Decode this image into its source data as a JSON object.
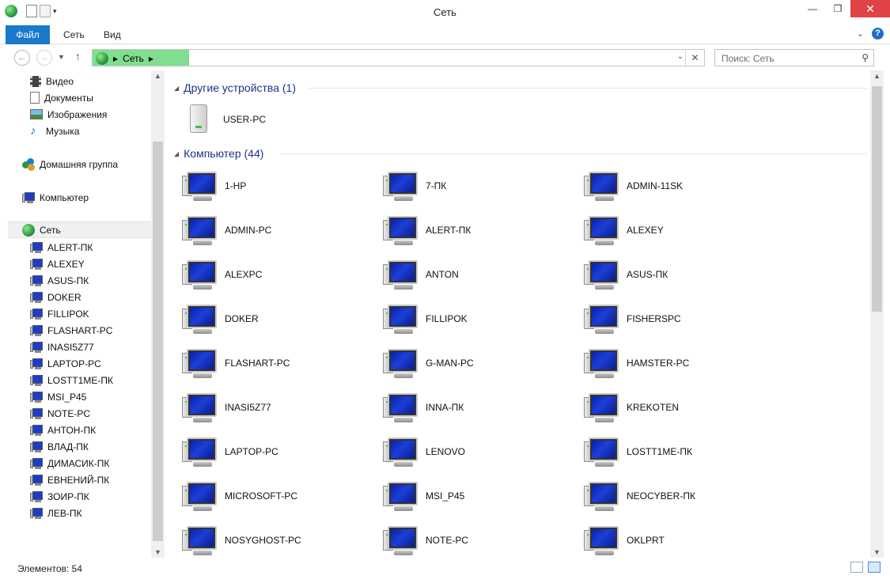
{
  "window": {
    "title": "Сеть"
  },
  "ribbon": {
    "tabs": [
      "Файл",
      "Сеть",
      "Вид"
    ]
  },
  "address": {
    "crumb": "Сеть"
  },
  "search": {
    "placeholder": "Поиск: Сеть"
  },
  "nav": {
    "libraries": [
      "Видео",
      "Документы",
      "Изображения",
      "Музыка"
    ],
    "homegroup": "Домашняя группа",
    "computer": "Компьютер",
    "network": "Сеть",
    "network_items": [
      "ALERT-ПК",
      "ALEXEY",
      "ASUS-ПК",
      "DOKER",
      "FILLIPOK",
      "FLASHART-PC",
      "INASI5Z77",
      "LAPTOP-PC",
      "LOSTT1ME-ПК",
      "MSI_P45",
      "NOTE-PC",
      "АНТОН-ПК",
      "ВЛАД-ПК",
      "ДИМАСИК-ПК",
      "ЕВНЕНИЙ-ПК",
      "ЗОИР-ПК",
      "ЛЕВ-ПК"
    ]
  },
  "groups": {
    "other": {
      "title": "Другие устройства (1)",
      "items": [
        "USER-PC"
      ]
    },
    "computers": {
      "title": "Компьютер (44)",
      "items": [
        "1-HP",
        "7-ПК",
        "ADMIN-11SK",
        "ADMIN-PC",
        "ALERT-ПК",
        "ALEXEY",
        "ALEXPC",
        "ANTON",
        "ASUS-ПК",
        "DOKER",
        "FILLIPOK",
        "FISHERSPC",
        "FLASHART-PC",
        "G-MAN-PC",
        "HAMSTER-PC",
        "INASI5Z77",
        "INNA-ПК",
        "KREKOTEN",
        "LAPTOP-PC",
        "LENOVO",
        "LOSTT1ME-ПК",
        "MICROSOFT-PC",
        "MSI_P45",
        "NEOCYBER-ПК",
        "NOSYGHOST-PC",
        "NOTE-PC",
        "OKLPRT"
      ]
    }
  },
  "status": {
    "text": "Элементов: 54"
  }
}
